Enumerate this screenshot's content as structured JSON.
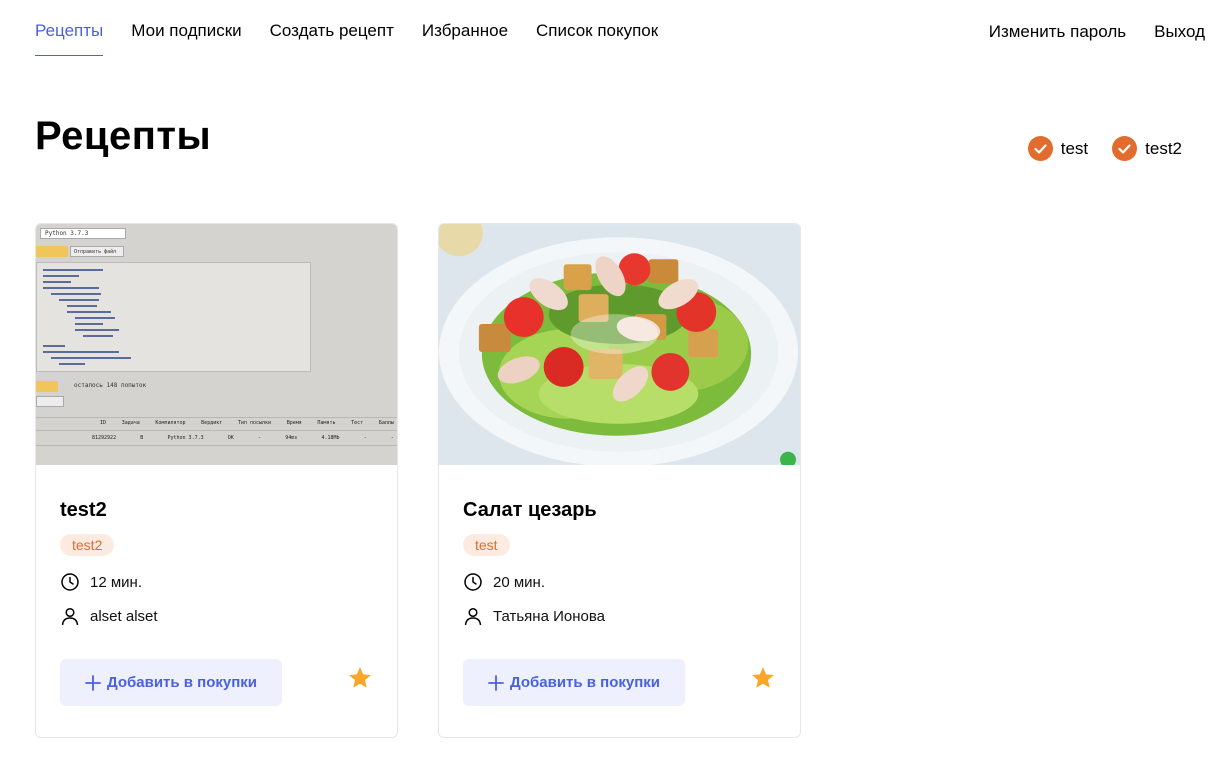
{
  "nav": {
    "left": [
      "Рецепты",
      "Мои подписки",
      "Создать рецепт",
      "Избранное",
      "Список покупок"
    ],
    "right": [
      "Изменить пароль",
      "Выход"
    ],
    "active_index": 0
  },
  "page": {
    "title": "Рецепты"
  },
  "tag_filters": [
    {
      "label": "test",
      "checked": true,
      "color": "#E26C2D"
    },
    {
      "label": "test2",
      "checked": true,
      "color": "#E26C2D"
    }
  ],
  "recipes": [
    {
      "title": "test2",
      "tag": "test2",
      "time": "12 мин.",
      "author": "alset alset",
      "add_label": "Добавить в покупки",
      "favorite": true,
      "image": {
        "select_label": "Python 3.7.3",
        "btn_b_label": "Отправить файл",
        "status_label": "осталось 148 попыток",
        "table_headers": [
          "ID",
          "Задача",
          "Компилятор",
          "Вердикт",
          "Тип посылки",
          "Время",
          "Память",
          "Тест",
          "Баллы"
        ],
        "table_values": [
          "81292922",
          "B",
          "Python 3.7.3",
          "OK",
          "-",
          "94ms",
          "4.18Mb",
          "-",
          "-"
        ]
      }
    },
    {
      "title": "Салат цезарь",
      "tag": "test",
      "time": "20 мин.",
      "author": "Татьяна Ионова",
      "add_label": "Добавить в покупки",
      "favorite": true
    }
  ],
  "colors": {
    "accent": "#4A61DD",
    "tag": "#E26C2D",
    "star": "#F9A62B"
  }
}
